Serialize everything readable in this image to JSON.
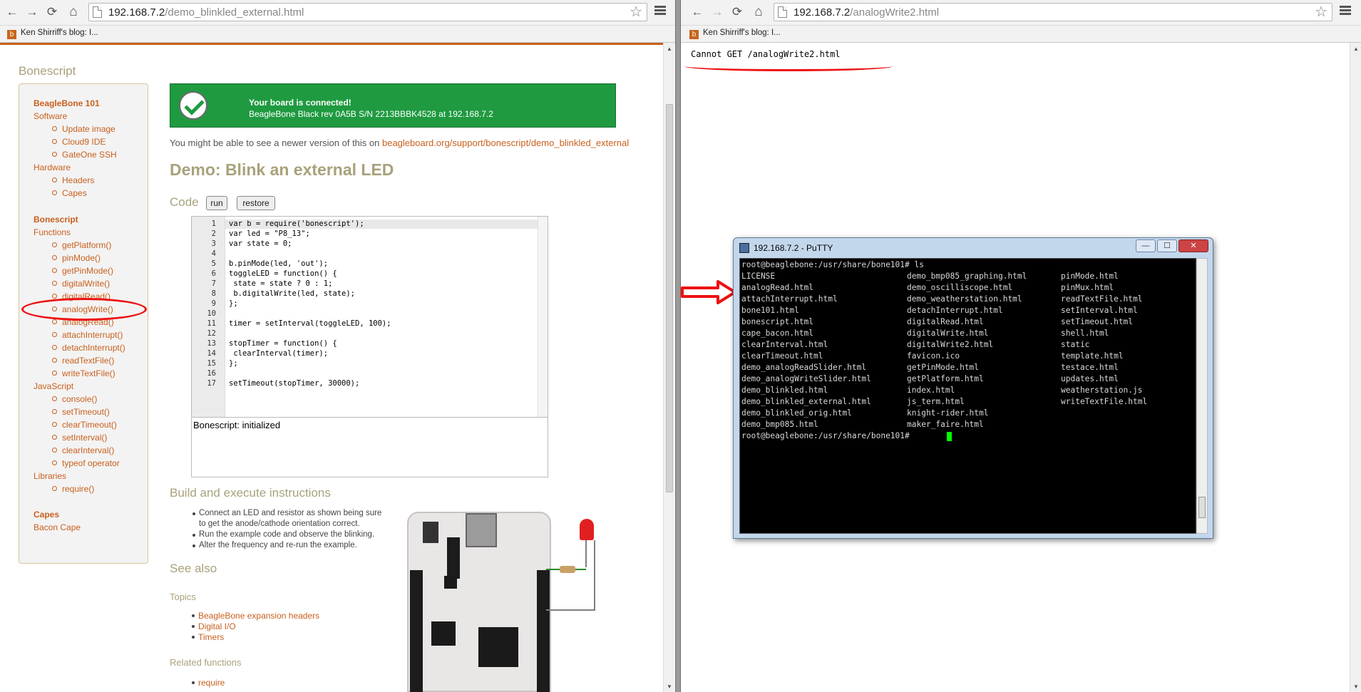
{
  "left_browser": {
    "url_host": "192.168.7.2",
    "url_path": "/demo_blinkled_external.html",
    "bookmark": "Ken Shirriff's blog: I..."
  },
  "right_browser": {
    "url_host": "192.168.7.2",
    "url_path": "/analogWrite2.html",
    "bookmark": "Ken Shirriff's blog: I...",
    "error_text": "Cannot GET /analogWrite2.html"
  },
  "icons": {
    "back": "←",
    "forward": "→",
    "reload": "⟳",
    "home": "⌂",
    "star": "☆"
  },
  "page": {
    "brand": "Bonescript",
    "banner_line1": "Your board is connected!",
    "banner_line2": "BeagleBone Black rev 0A5B S/N 2213BBBK4528 at 192.168.7.2",
    "newer_prefix": "You might be able to see a newer version of this on ",
    "newer_link": "beagleboard.org/support/bonescript/demo_blinkled_external",
    "title": "Demo: Blink an external LED",
    "code_heading": "Code",
    "run_label": "run",
    "restore_label": "restore",
    "console_text": "Bonescript: initialized",
    "build_heading": "Build and execute instructions",
    "build_items": [
      "Connect an LED and resistor as shown being sure",
      "to get the anode/cathode orientation correct.",
      "Run the example code and observe the blinking.",
      "Alter the frequency and re-run the example."
    ],
    "see_also": "See also",
    "topics_heading": "Topics",
    "topics": [
      "BeagleBone expansion headers",
      "Digital I/O",
      "Timers"
    ],
    "related_heading": "Related functions",
    "related": [
      "require"
    ]
  },
  "sidebar": {
    "beaglebone101": "BeagleBone 101",
    "software": "Software",
    "software_items": [
      "Update image",
      "Cloud9 IDE",
      "GateOne SSH"
    ],
    "hardware": "Hardware",
    "hardware_items": [
      "Headers",
      "Capes"
    ],
    "bonescript": "Bonescript",
    "functions": "Functions",
    "function_items": [
      "getPlatform()",
      "pinMode()",
      "getPinMode()",
      "digitalWrite()",
      "digitalRead()",
      "analogWrite()",
      "analogRead()",
      "attachInterrupt()",
      "detachInterrupt()",
      "readTextFile()",
      "writeTextFile()"
    ],
    "javascript": "JavaScript",
    "js_items": [
      "console()",
      "setTimeout()",
      "clearTimeout()",
      "setInterval()",
      "clearInterval()",
      "typeof operator"
    ],
    "libraries": "Libraries",
    "lib_items": [
      "require()"
    ],
    "capes": "Capes",
    "bacon_cape": "Bacon Cape"
  },
  "code": {
    "line_numbers": [
      "1",
      "2",
      "3",
      "4",
      "5",
      "6",
      "7",
      "8",
      "9",
      "10",
      "11",
      "12",
      "13",
      "14",
      "15",
      "16",
      "17"
    ],
    "lines": [
      "var b = require('bonescript');",
      "var led = \"P8_13\";",
      "var state = 0;",
      "",
      "b.pinMode(led, 'out');",
      "toggleLED = function() {",
      " state = state ? 0 : 1;",
      " b.digitalWrite(led, state);",
      "};",
      "",
      "timer = setInterval(toggleLED, 100);",
      "",
      "stopTimer = function() {",
      " clearInterval(timer);",
      "};",
      "",
      "setTimeout(stopTimer, 30000);"
    ]
  },
  "putty": {
    "title": "192.168.7.2 - PuTTY",
    "prompt_line": "root@beaglebone:/usr/share/bone101# ls",
    "col1": [
      "LICENSE",
      "analogRead.html",
      "attachInterrupt.html",
      "bone101.html",
      "bonescript.html",
      "cape_bacon.html",
      "clearInterval.html",
      "clearTimeout.html",
      "demo_analogReadSlider.html",
      "demo_analogWriteSlider.html",
      "demo_blinkled.html",
      "demo_blinkled_external.html",
      "demo_blinkled_orig.html",
      "demo_bmp085.html"
    ],
    "col2": [
      "demo_bmp085_graphing.html",
      "demo_oscilliscope.html",
      "demo_weatherstation.html",
      "detachInterrupt.html",
      "digitalRead.html",
      "digitalWrite.html",
      "digitalWrite2.html",
      "favicon.ico",
      "getPinMode.html",
      "getPlatform.html",
      "index.html",
      "js_term.html",
      "knight-rider.html",
      "maker_faire.html"
    ],
    "col3": [
      "pinMode.html",
      "pinMux.html",
      "readTextFile.html",
      "setInterval.html",
      "setTimeout.html",
      "shell.html",
      "static",
      "template.html",
      "testace.html",
      "updates.html",
      "weatherstation.js",
      "writeTextFile.html"
    ],
    "final_prompt": "root@beaglebone:/usr/share/bone101#",
    "min_label": "—",
    "max_label": "☐",
    "close_label": "✕"
  },
  "colors": {
    "accent": "#c8601e",
    "heading": "#a8a27c",
    "banner": "#1f9a40",
    "annotation": "#e11111",
    "cursor": "#00ff00"
  }
}
